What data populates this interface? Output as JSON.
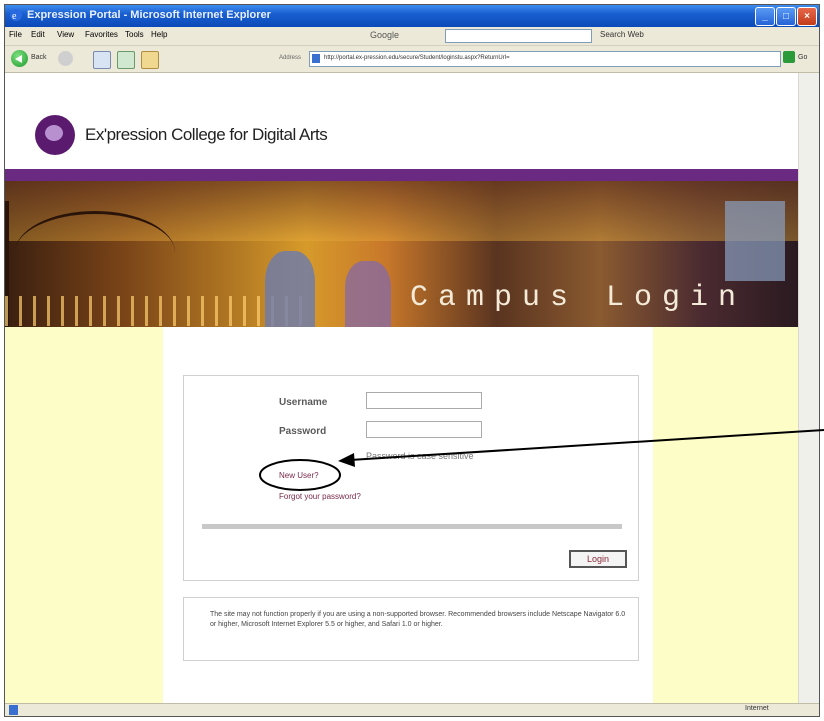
{
  "window": {
    "title": "Expression Portal - Microsoft Internet Explorer"
  },
  "menubar": {
    "items": [
      "File",
      "Edit",
      "View",
      "Favorites",
      "Tools",
      "Help"
    ],
    "google_label": "Google",
    "search_web_label": "Search Web"
  },
  "toolbar": {
    "back_label": "Back",
    "address_label": "Address",
    "url": "http://portal.ex-pression.edu/secure/Student/loginstu.aspx?ReturnUrl=",
    "go_label": "Go"
  },
  "site": {
    "name": "Ex'pression College for Digital Arts",
    "banner_text": "Campus Login"
  },
  "login": {
    "username_label": "Username",
    "password_label": "Password",
    "username_value": "",
    "password_value": "",
    "password_hint": "Password is case sensitive",
    "new_user_link": "New User?",
    "forgot_link": "Forgot your password?",
    "login_button": "Login"
  },
  "notice": {
    "text": "The site may not function properly if you are using a non-supported browser. Recommended browsers include Netscape Navigator 6.0 or higher, Microsoft Internet Explorer 5.5 or higher, and Safari 1.0 or higher."
  },
  "statusbar": {
    "zone": "Internet"
  }
}
